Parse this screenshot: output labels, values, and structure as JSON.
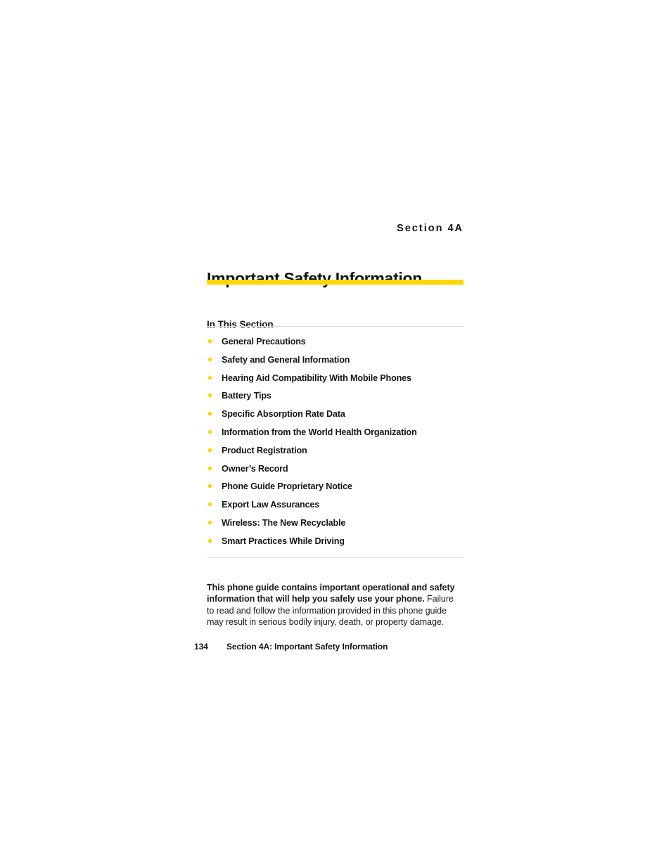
{
  "document": {
    "section_eyebrow": "Section 4A",
    "title": "Important Safety Information",
    "subhead": "In This Section",
    "accent_color": "#ffd700",
    "rule_color": "#dddddd",
    "bullet_icon": "diamond-bullet-icon"
  },
  "toc": {
    "items": [
      {
        "label": "General Precautions"
      },
      {
        "label": "Safety and General Information"
      },
      {
        "label": "Hearing Aid Compatibility With Mobile Phones"
      },
      {
        "label": "Battery Tips"
      },
      {
        "label": "Specific Absorption Rate Data"
      },
      {
        "label": "Information from the World Health Organization"
      },
      {
        "label": "Product Registration"
      },
      {
        "label": "Owner’s Record"
      },
      {
        "label": "Phone Guide Proprietary Notice"
      },
      {
        "label": "Export Law Assurances"
      },
      {
        "label": "Wireless: The New Recyclable"
      },
      {
        "label": "Smart Practices While Driving"
      }
    ]
  },
  "notice": {
    "lead": "This phone guide contains important operational and safety information that will help you safely use your phone.",
    "body": " Failure to read and follow the information provided in this phone guide may result in serious bodily injury, death, or property damage."
  },
  "footer": {
    "page_number": "134",
    "running_head": "Section 4A: Important Safety Information"
  }
}
